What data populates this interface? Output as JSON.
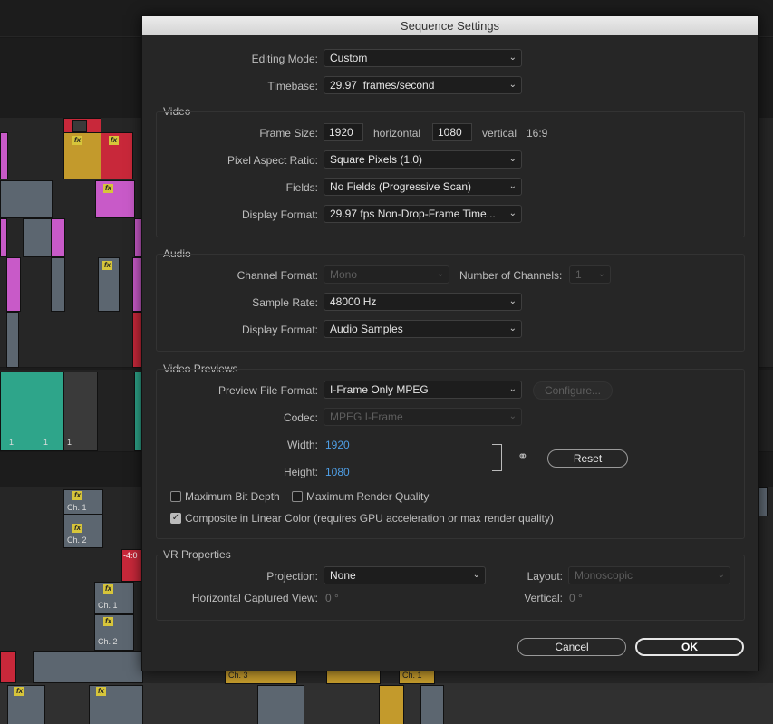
{
  "dialog": {
    "title": "Sequence Settings",
    "editing_mode_label": "Editing Mode:",
    "editing_mode_value": "Custom",
    "timebase_label": "Timebase:",
    "timebase_value": "29.97  frames/second",
    "video": {
      "section_title": "Video",
      "frame_size_label": "Frame Size:",
      "frame_width": "1920",
      "horizontal_label": "horizontal",
      "frame_height": "1080",
      "vertical_label": "vertical",
      "aspect": "16:9",
      "par_label": "Pixel Aspect Ratio:",
      "par_value": "Square Pixels (1.0)",
      "fields_label": "Fields:",
      "fields_value": "No Fields (Progressive Scan)",
      "display_format_label": "Display Format:",
      "display_format_value": "29.97 fps Non-Drop-Frame Time..."
    },
    "audio": {
      "section_title": "Audio",
      "channel_format_label": "Channel Format:",
      "channel_format_value": "Mono",
      "num_channels_label": "Number of Channels:",
      "num_channels_value": "1",
      "sample_rate_label": "Sample Rate:",
      "sample_rate_value": "48000 Hz",
      "display_format_label": "Display Format:",
      "display_format_value": "Audio Samples"
    },
    "previews": {
      "section_title": "Video Previews",
      "preview_format_label": "Preview File Format:",
      "preview_format_value": "I-Frame Only MPEG",
      "configure_label": "Configure...",
      "codec_label": "Codec:",
      "codec_value": "MPEG I-Frame",
      "width_label": "Width:",
      "width_value": "1920",
      "height_label": "Height:",
      "height_value": "1080",
      "reset_label": "Reset",
      "max_bit_depth_label": "Maximum Bit Depth",
      "max_render_quality_label": "Maximum Render Quality",
      "composite_label": "Composite in Linear Color (requires GPU acceleration or max render quality)"
    },
    "vr": {
      "section_title": "VR Properties",
      "projection_label": "Projection:",
      "projection_value": "None",
      "layout_label": "Layout:",
      "layout_value": "Monoscopic",
      "hcv_label": "Horizontal Captured View:",
      "hcv_value": "0 °",
      "vertical_label": "Vertical:",
      "vertical_value": "0 °"
    },
    "cancel_label": "Cancel",
    "ok_label": "OK"
  },
  "timeline": {
    "fx_badge": "fx",
    "ch1": "Ch. 1",
    "ch2": "Ch. 2",
    "track_num": "1",
    "clip_label_a": "Ch. 3",
    "clip_label_b": "Ch. 1",
    "marker": "-4:0"
  }
}
